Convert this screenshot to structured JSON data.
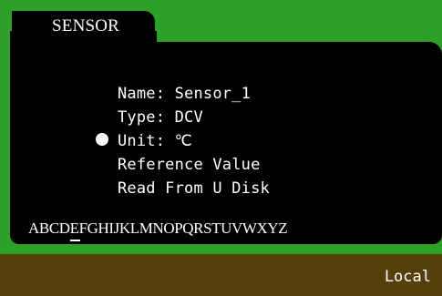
{
  "tab": {
    "label": "SENSOR"
  },
  "menu": {
    "items": [
      {
        "label": "Name: Sensor_1"
      },
      {
        "label": "Type: DCV"
      },
      {
        "label": "Unit: ℃"
      },
      {
        "label": "Reference Value"
      },
      {
        "label": "Read From U Disk"
      }
    ],
    "selected_index": 2,
    "selector_icon": "bullet-icon"
  },
  "keyboard": {
    "characters": "ABCDEFGHIJKLMNOPQRSTUVWXYZ",
    "cursor_character": "E"
  },
  "status": {
    "mode": "Local"
  },
  "colors": {
    "frame": "#2da02a",
    "panel": "#000000",
    "status_bar": "#573f0c",
    "text": "#ffffff"
  }
}
